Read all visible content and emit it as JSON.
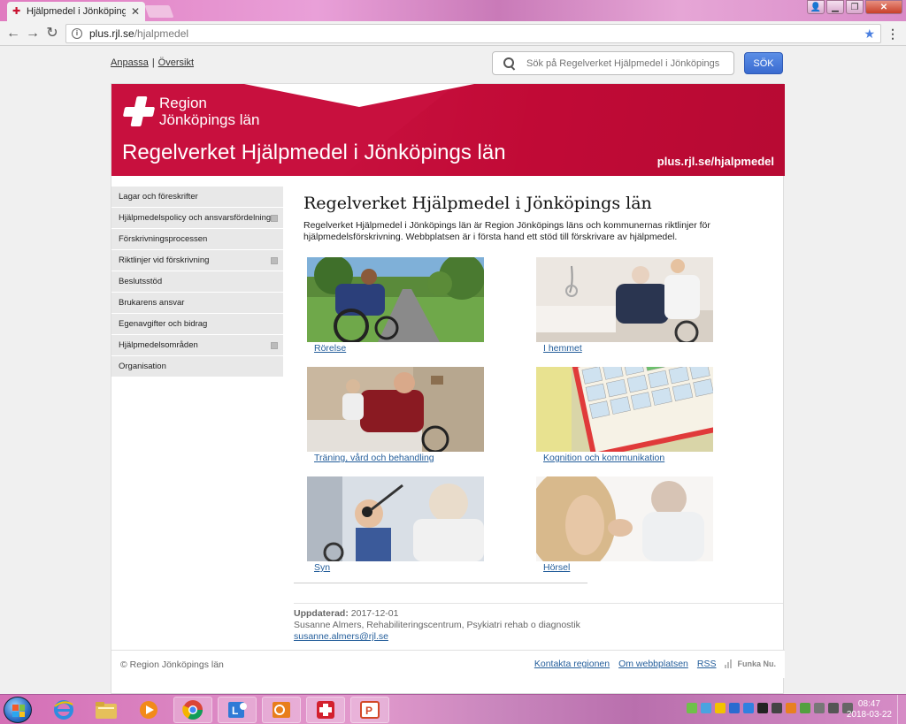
{
  "browser": {
    "tab_title": "Hjälpmedel i Jönköpings",
    "url_host": "plus.rjl.se",
    "url_path": "/hjalpmedel"
  },
  "header": {
    "links": [
      "Anpassa",
      "Översikt"
    ],
    "search_placeholder": "Sök på Regelverket Hjälpmedel i Jönköpings l",
    "search_button": "SÖK"
  },
  "banner": {
    "logo_line1": "Region",
    "logo_line2": "Jönköpings län",
    "title": "Regelverket Hjälpmedel i Jönköpings län",
    "url": "plus.rjl.se/hjalpmedel",
    "color": "#c8103e"
  },
  "sidebar": {
    "items": [
      {
        "label": "Lagar och föreskrifter",
        "expandable": false
      },
      {
        "label": "Hjälpmedelspolicy och ansvarsfördelning",
        "expandable": true
      },
      {
        "label": "Förskrivningsprocessen",
        "expandable": false
      },
      {
        "label": "Riktlinjer vid förskrivning",
        "expandable": true
      },
      {
        "label": "Beslutsstöd",
        "expandable": false
      },
      {
        "label": "Brukarens ansvar",
        "expandable": false
      },
      {
        "label": "Egenavgifter och bidrag",
        "expandable": false
      },
      {
        "label": "Hjälpmedelsområden",
        "expandable": true
      },
      {
        "label": "Organisation",
        "expandable": false
      }
    ]
  },
  "main": {
    "heading": "Regelverket Hjälpmedel i Jönköpings län",
    "intro": "Regelverket Hjälpmedel i Jönköpings län är Region Jönköpings läns och kommunernas riktlinjer för hjälpmedelsförskrivning. Webbplatsen är i första hand ett stöd till förskrivare av hjälpmedel.",
    "tiles": [
      {
        "caption": "Rörelse"
      },
      {
        "caption": "I hemmet"
      },
      {
        "caption": "Träning, vård och behandling"
      },
      {
        "caption": "Kognition och kommunikation"
      },
      {
        "caption": "Syn"
      },
      {
        "caption": "Hörsel"
      }
    ]
  },
  "updated": {
    "label": "Uppdaterad:",
    "date": "2017-12-01",
    "author": "Susanne Almers, Rehabiliteringscentrum, Psykiatri rehab o diagnostik",
    "email": "susanne.almers@rjl.se"
  },
  "footer": {
    "copyright": "© Region Jönköpings län",
    "links": [
      "Kontakta regionen",
      "Om webbplatsen",
      "RSS"
    ],
    "funka": "Funka Nu."
  },
  "taskbar": {
    "time": "08:47",
    "date": "2018-03-22"
  }
}
